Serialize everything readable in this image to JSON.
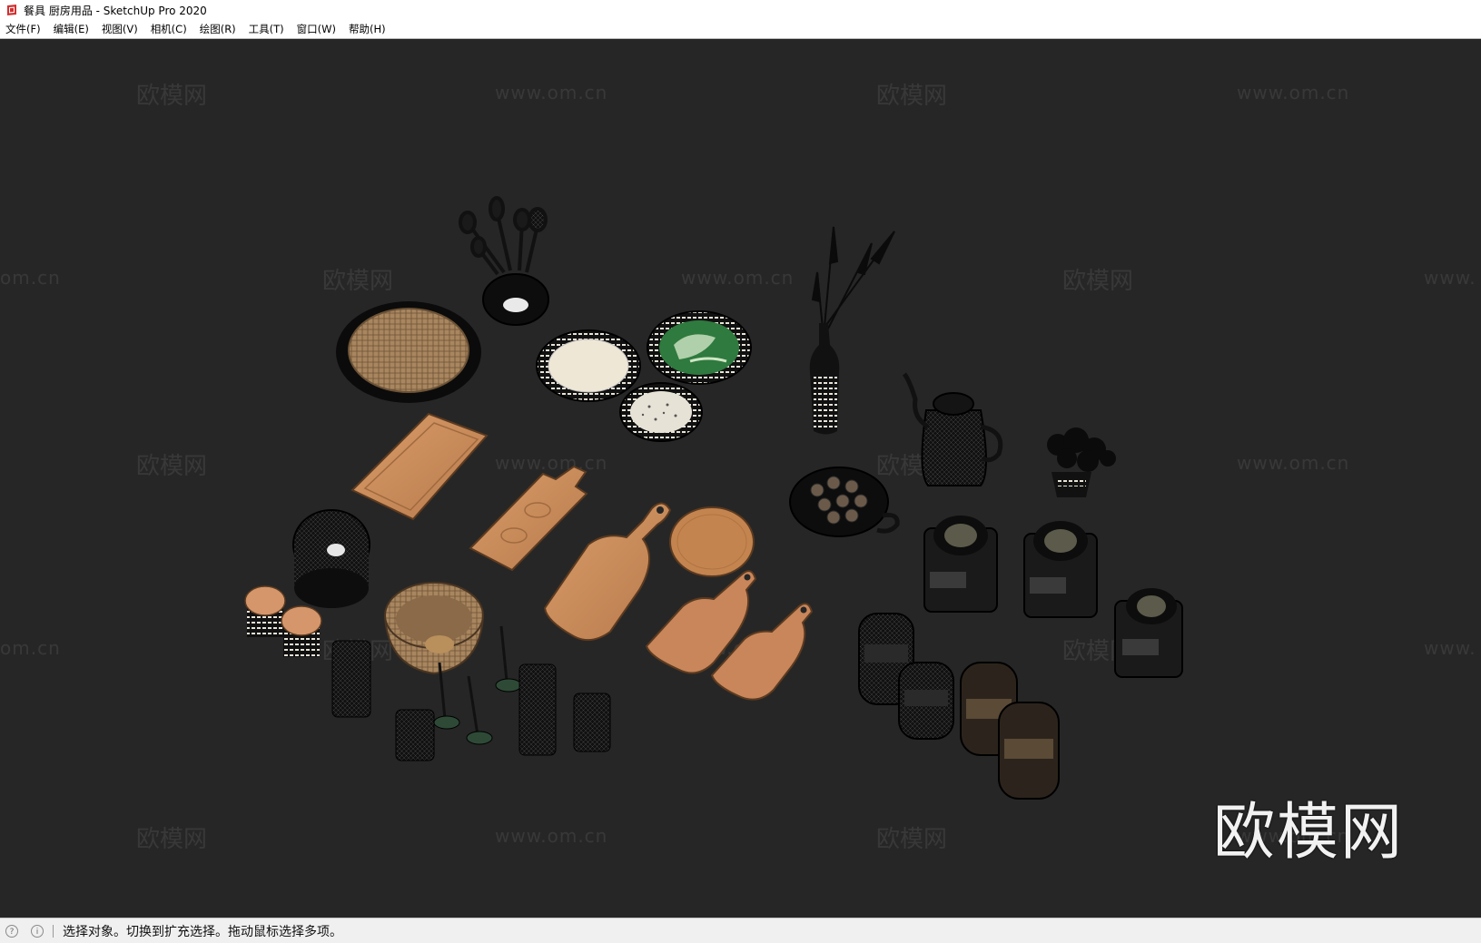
{
  "window": {
    "title": "餐具 厨房用品 - SketchUp Pro 2020"
  },
  "menu": [
    {
      "id": "file",
      "label": "文件(F)"
    },
    {
      "id": "edit",
      "label": "编辑(E)"
    },
    {
      "id": "view",
      "label": "视图(V)"
    },
    {
      "id": "camera",
      "label": "相机(C)"
    },
    {
      "id": "draw",
      "label": "绘图(R)"
    },
    {
      "id": "tools",
      "label": "工具(T)"
    },
    {
      "id": "window",
      "label": "窗口(W)"
    },
    {
      "id": "help",
      "label": "帮助(H)"
    }
  ],
  "watermark": {
    "brand": "欧模网",
    "url": "www.om.cn",
    "partial_url_left": "om.cn",
    "partial_url_right": "www.",
    "large_logo": "欧模网"
  },
  "status": {
    "icons": [
      "geo-location-icon",
      "info-icon"
    ],
    "message": "选择对象。切换到扩充选择。拖动鼠标选择多项。"
  },
  "colors": {
    "viewport_bg": "#262626",
    "wood": "#c98a5a",
    "wicker": "#a88660",
    "green": "#2f7a3e"
  }
}
